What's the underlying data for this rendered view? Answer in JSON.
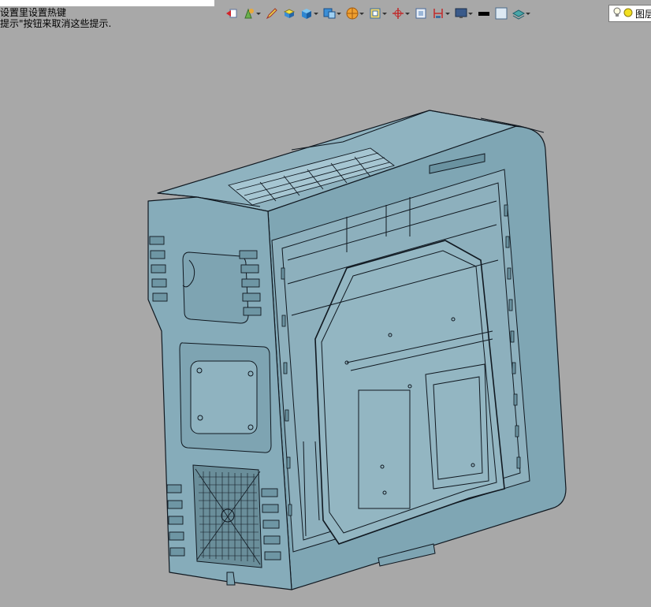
{
  "hint": {
    "line1": "设置里设置热键",
    "line2": "提示\"按钮来取消这些提示."
  },
  "toolbar": {
    "icons": [
      {
        "name": "exit-sketch-icon",
        "dropdown": false
      },
      {
        "name": "paint-icon",
        "dropdown": true
      },
      {
        "name": "pencil-icon",
        "dropdown": false
      },
      {
        "name": "shaded-solid-icon",
        "dropdown": false
      },
      {
        "name": "view-cube-icon",
        "dropdown": true
      },
      {
        "name": "display-style-icon",
        "dropdown": true
      },
      {
        "name": "orange-sphere-icon",
        "dropdown": true
      },
      {
        "name": "section-view-icon",
        "dropdown": true
      },
      {
        "name": "axis-icon",
        "dropdown": true
      },
      {
        "name": "frame-icon",
        "dropdown": false
      },
      {
        "name": "dimension-icon",
        "dropdown": true
      },
      {
        "name": "monitor-icon",
        "dropdown": true
      },
      {
        "name": "line-weight-icon",
        "dropdown": false
      },
      {
        "name": "color-swatch-icon",
        "dropdown": false
      },
      {
        "name": "layer-stack-icon",
        "dropdown": true
      }
    ],
    "layer_label": "图层"
  },
  "colors": {
    "background": "#a8a8a8",
    "model_fill": "#7fa6b4",
    "model_edge": "#101820"
  }
}
